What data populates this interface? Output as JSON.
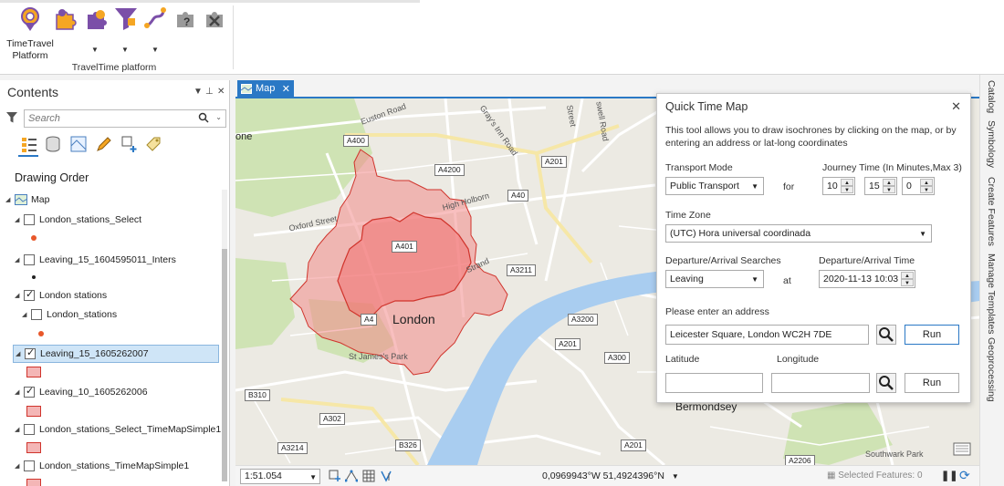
{
  "ribbon": {
    "big_button_label": "TimeTravel\nPlatform",
    "group_label": "TravelTime platform",
    "icons": [
      "timetravel-pin-icon",
      "puzzle-icon",
      "puzzle-star-icon",
      "filter-funnel-icon",
      "route-icon",
      "help-puzzle-icon",
      "tools-puzzle-icon"
    ]
  },
  "contents": {
    "title": "Contents",
    "search_placeholder": "Search",
    "drawing_order_label": "Drawing Order",
    "layers": [
      {
        "label": "Map"
      },
      {
        "label": "London_stations_Select"
      },
      {
        "label": "Leaving_15_1604595011_Inters"
      },
      {
        "label": "London stations"
      },
      {
        "label": "London_stations"
      },
      {
        "label": "Leaving_15_1605262007"
      },
      {
        "label": "Leaving_10_1605262006"
      },
      {
        "label": "London_stations_Select_TimeMapSimple1"
      },
      {
        "label": "London_stations_TimeMapSimple1"
      }
    ]
  },
  "map_tab": {
    "label": "Map",
    "close": "✕"
  },
  "map": {
    "place_labels": {
      "london": "London",
      "bermondsey": "Bermondsey",
      "one": "one"
    },
    "road_labels": {
      "a400": "A400",
      "a4200": "A4200",
      "a40": "A40",
      "a201_top": "A201",
      "a401": "A401",
      "a4": "A4",
      "a3211": "A3211",
      "a3200": "A3200",
      "a201_mid": "A201",
      "a300": "A300",
      "b310": "B310",
      "a302": "A302",
      "a3214": "A3214",
      "b326": "B326",
      "a201_bot": "A201",
      "a2206": "A2206"
    },
    "street_labels": {
      "euston": "Euston Road",
      "grays_inn": "Gray's Inn Road",
      "oxford": "Oxford Street",
      "high_holborn": "High Holborn",
      "strand": "Strand",
      "st_james": "St James's Park",
      "southwark": "Southwark Park",
      "street": "Street",
      "swell": "swell Road"
    }
  },
  "status": {
    "scale": "1:51.054",
    "coordinates": "0,0969943°W 51,4924396°N",
    "selected_features": "Selected Features: 0"
  },
  "side_tabs": [
    "Catalog",
    "Symbology",
    "Create Features",
    "Manage Templates",
    "Geoprocessing"
  ],
  "dialog": {
    "title": "Quick Time Map",
    "close": "✕",
    "description": "This tool allows you to draw isochrones by clicking on the map, or by entering an address or lat-long coordinates",
    "transport_mode_label": "Transport Mode",
    "transport_mode_value": "Public Transport",
    "for_label": "for",
    "journey_time_label": "Journey Time (In Minutes,Max 3)",
    "journey_values": [
      "10",
      "15",
      "0"
    ],
    "time_zone_label": "Time Zone",
    "time_zone_value": "(UTC) Hora universal coordinada",
    "searches_label": "Departure/Arrival Searches",
    "searches_value": "Leaving",
    "at_label": "at",
    "time_label": "Departure/Arrival Time",
    "time_value": "2020-11-13 10:03",
    "address_label": "Please enter an address",
    "address_value": "Leicester Square, London WC2H 7DE",
    "run_label": "Run",
    "latitude_label": "Latitude",
    "longitude_label": "Longitude",
    "latitude_value": "",
    "longitude_value": ""
  },
  "colors": {
    "accent": "#2a78c5",
    "isochrone_fill": "#f28b8b",
    "isochrone_stroke": "#d0342c",
    "water": "#a9cdf0",
    "park": "#cfe3b4"
  }
}
